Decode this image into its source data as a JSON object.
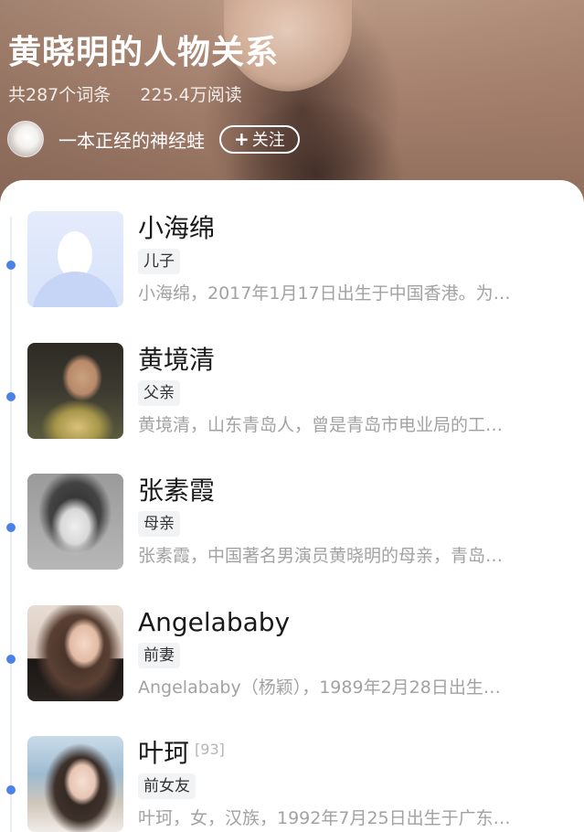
{
  "header": {
    "title": "黄晓明的人物关系",
    "entries": "共287个词条",
    "reads": "225.4万阅读",
    "author": "一本正经的神经蛙",
    "follow_label": "关注",
    "follow_icon": "plus-icon"
  },
  "relations": [
    {
      "name": "小海绵",
      "ref": "",
      "tag": "儿子",
      "desc": "小海绵，2017年1月17日出生于中国香港。为…"
    },
    {
      "name": "黄境清",
      "ref": "",
      "tag": "父亲",
      "desc": "黄境清，山东青岛人，曾是青岛市电业局的工…"
    },
    {
      "name": "张素霞",
      "ref": "",
      "tag": "母亲",
      "desc": "张素霞，中国著名男演员黄晓明的母亲，青岛…"
    },
    {
      "name": "Angelababy",
      "ref": "",
      "tag": "前妻",
      "desc": "Angelababy（杨颖），1989年2月28日出生…"
    },
    {
      "name": "叶珂",
      "ref": "[93]",
      "tag": "前女友",
      "desc": "叶珂，女，汉族，1992年7月25日出生于广东…"
    }
  ],
  "colors": {
    "timeline_dot": "#4b82e8",
    "tag_bg": "#f2f3f5",
    "desc_text": "#a2a2a2"
  }
}
